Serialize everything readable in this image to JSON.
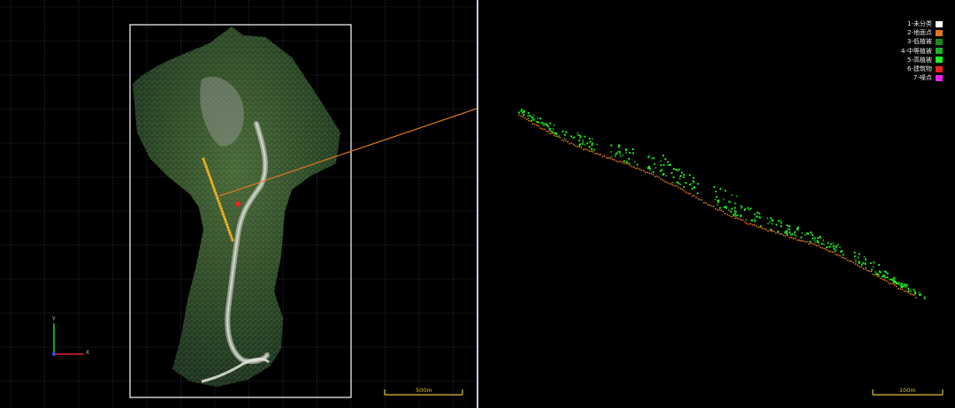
{
  "left_view": {
    "scale_bar": {
      "label": "500m",
      "color": "#e0c030"
    },
    "axis": {
      "x_label": "X",
      "y_label": "Y",
      "x_color": "#e02020",
      "y_color": "#20d020",
      "z_color": "#3050ff"
    },
    "grid_color": "#3a3f55",
    "bbox_color": "#ffffff",
    "profile_line_color": "#e07820",
    "sample_points_color": "#f0b020",
    "marker_color": "#ff2020"
  },
  "right_view": {
    "scale_bar": {
      "label": "100m",
      "color": "#e0c030"
    },
    "legend": [
      {
        "label": "1-未分类",
        "color": "#ffffff"
      },
      {
        "label": "2-地面点",
        "color": "#e07820"
      },
      {
        "label": "3-低植被",
        "color": "#1a8a1a"
      },
      {
        "label": "4-中等植被",
        "color": "#22b022"
      },
      {
        "label": "5-高植被",
        "color": "#22ee22"
      },
      {
        "label": "6-建筑物",
        "color": "#ee2020"
      },
      {
        "label": "7-噪点",
        "color": "#ee20ee"
      }
    ]
  }
}
